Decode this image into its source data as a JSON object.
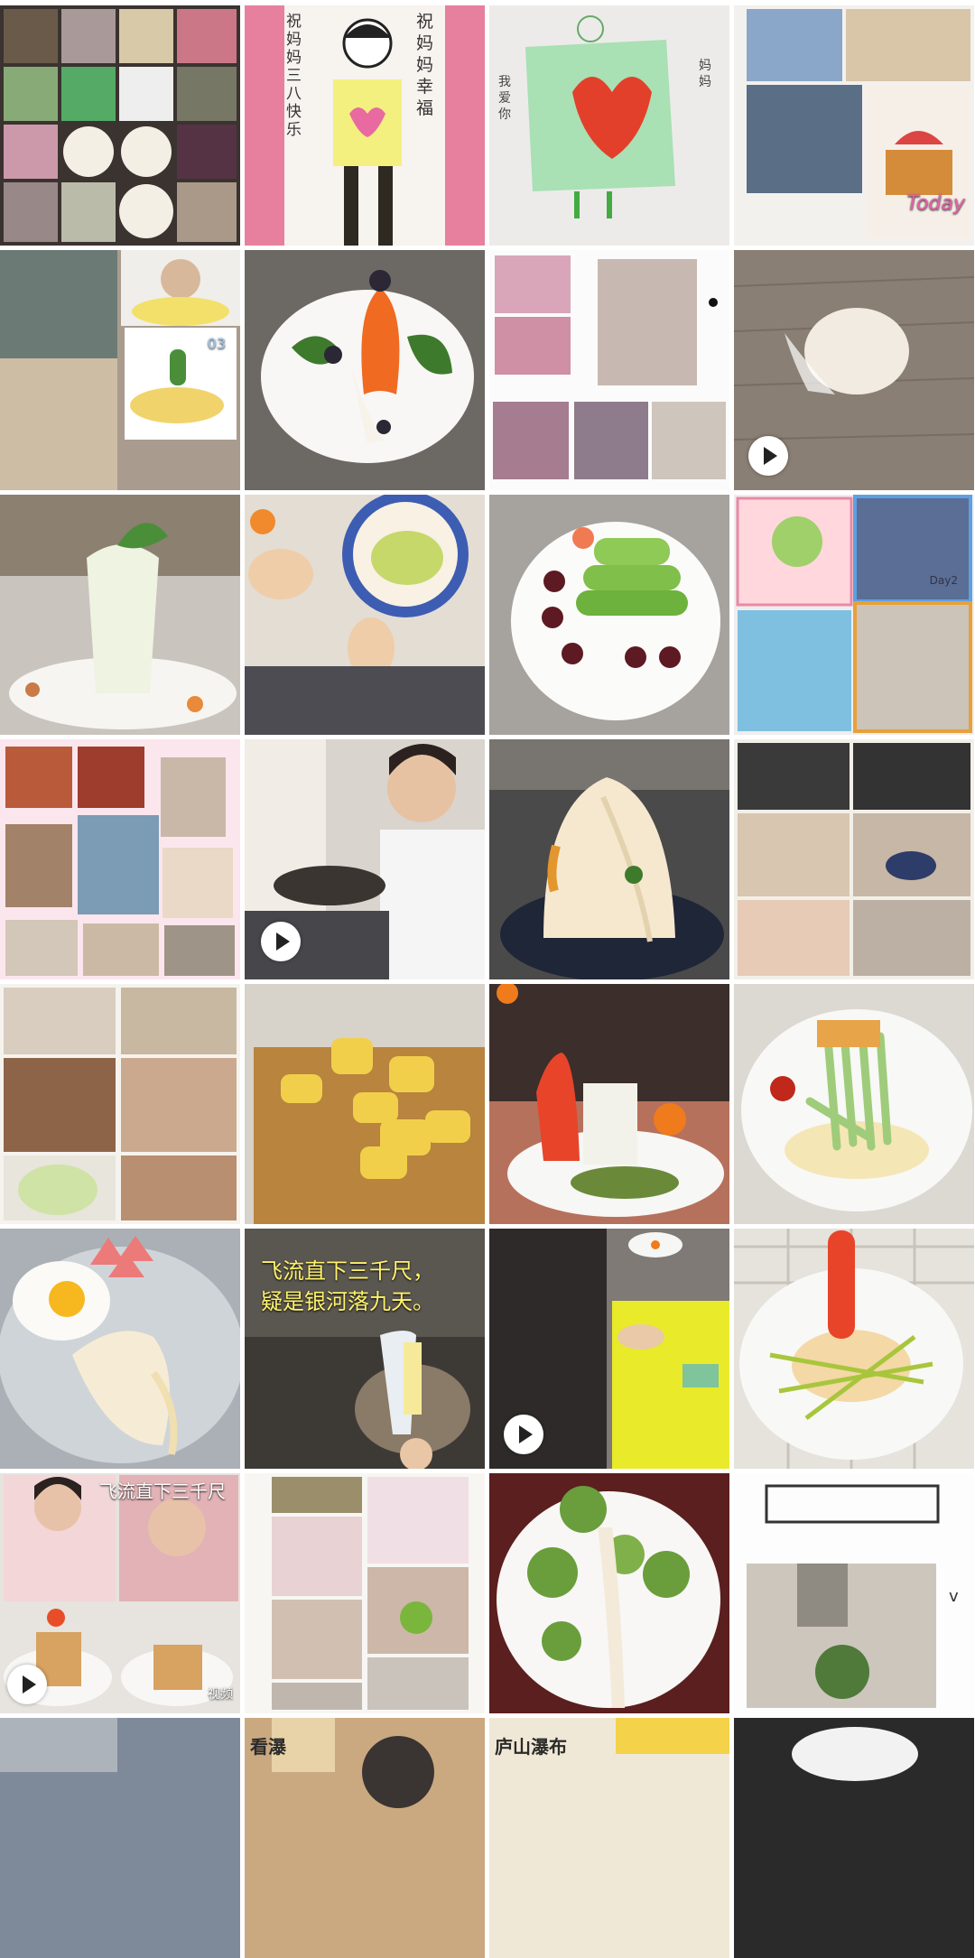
{
  "gallery": {
    "title": "",
    "tiles": [
      {
        "label": "collage-kids-cooking"
      },
      {
        "label": "drawing-mother-day"
      },
      {
        "label": "drawing-heart-card"
      },
      {
        "label": "collage-boy-cake"
      },
      {
        "label": "boy-kitchen-cucumber"
      },
      {
        "label": "carrot-rocket-dish"
      },
      {
        "label": "collage-girl-kitchen"
      },
      {
        "label": "dough-ball-video",
        "video": true
      },
      {
        "label": "cabbage-tree-dish"
      },
      {
        "label": "child-hands-salad"
      },
      {
        "label": "cucumber-tower-dish"
      },
      {
        "label": "collage-day2"
      },
      {
        "label": "collage-pink-frame"
      },
      {
        "label": "boy-stir-fry-video",
        "video": true
      },
      {
        "label": "noodle-mountain-dish"
      },
      {
        "label": "collage-child-cooking"
      },
      {
        "label": "collage-girl-white"
      },
      {
        "label": "corn-noodles-board"
      },
      {
        "label": "carrot-pagoda-dish"
      },
      {
        "label": "cucumber-egg-dish"
      },
      {
        "label": "egg-noodles-plate"
      },
      {
        "label": "waterfall-poem-video"
      },
      {
        "label": "cutting-yellow-board-video",
        "video": true
      },
      {
        "label": "sausage-noodle-nest"
      },
      {
        "label": "girl-bread-noodles-video",
        "video": true
      },
      {
        "label": "collage-girl-pink"
      },
      {
        "label": "broccoli-tree-dish"
      },
      {
        "label": "kitchen-pot-frame"
      },
      {
        "label": "partial-tile-1"
      },
      {
        "label": "partial-tile-2"
      },
      {
        "label": "partial-tile-3"
      },
      {
        "label": "partial-tile-4"
      }
    ]
  },
  "overlays": {
    "drawing_left_text": "祝妈妈三八快乐",
    "drawing_right_text": "祝妈妈幸福",
    "heart_left_text": "我爱你",
    "heart_right_text": "妈妈",
    "collage_today": "Today",
    "boy_kitchen_badge": "03",
    "day2_label": "Day2",
    "poem_line_1": "飞流直下三千尺，",
    "poem_line_2": "疑是银河落九天。",
    "poem_top_partial": "飞流直下三千尺",
    "video_label": "视频",
    "partial_sign_1": "看瀑",
    "partial_sign_2": "庐山瀑布"
  },
  "colors": {
    "background": "#ffffff",
    "play_button": "#ffffff",
    "poem_text": "#fff36a"
  }
}
